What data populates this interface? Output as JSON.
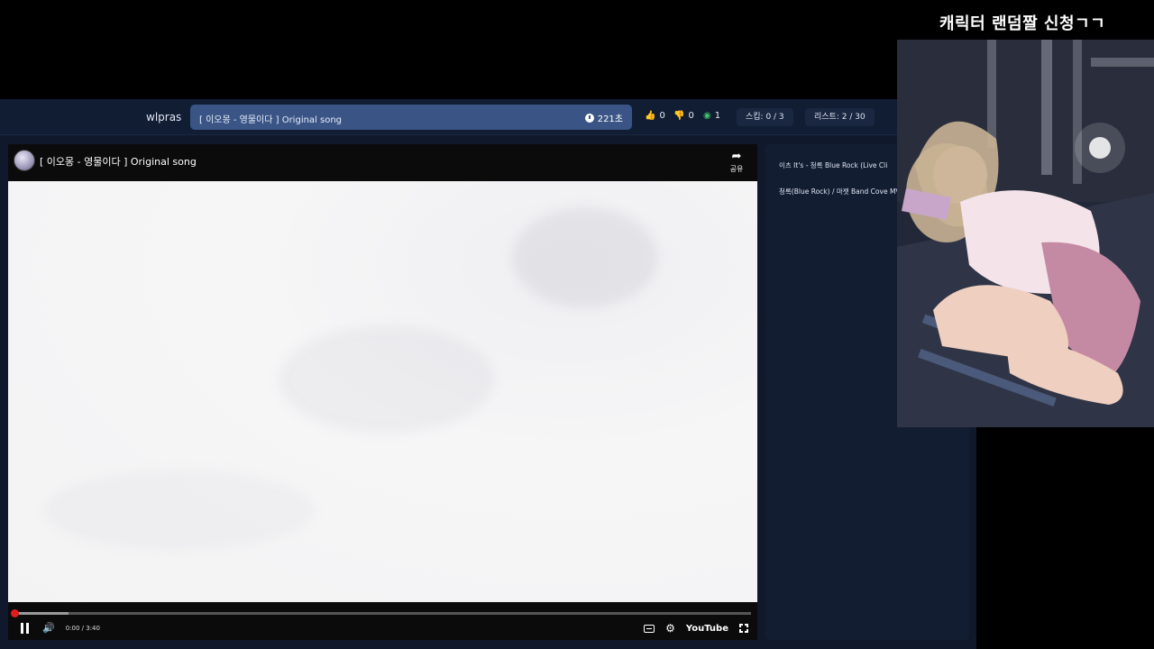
{
  "overlay": {
    "title": "캐릭터 랜덤짤 신청ㄱㄱ"
  },
  "topbar": {
    "username": "wlpras",
    "song_title": "[ 이오몽 - 영물이다 ] Original song",
    "duration": "221초",
    "likes": "0",
    "dislikes": "0",
    "viewers": "1",
    "skip": "스킵: 0 / 3",
    "list": "리스트: 2 / 30"
  },
  "player": {
    "title": "[ 이오몽 - 영물이다 ] Original song",
    "share_label": "공유",
    "time": "0:00 / 3:40",
    "progress": 0.0,
    "youtube_label": "YouTube"
  },
  "playlist": {
    "items": [
      {
        "text": "이츠 It's - 청록 Blue Rock (Live Cli"
      },
      {
        "text": "청록(Blue Rock) / 마젯 Band Cove MV】"
      }
    ]
  },
  "icons": {
    "like": "thumbs-up-icon",
    "dislike": "thumbs-down-icon",
    "viewers": "eye-icon",
    "clock": "clock-icon"
  },
  "colors": {
    "accent": "#3a5585",
    "like": "#4f8cf2",
    "dislike": "#e0505a",
    "viewers": "#3fc06a",
    "progress": "#e41b1b"
  }
}
